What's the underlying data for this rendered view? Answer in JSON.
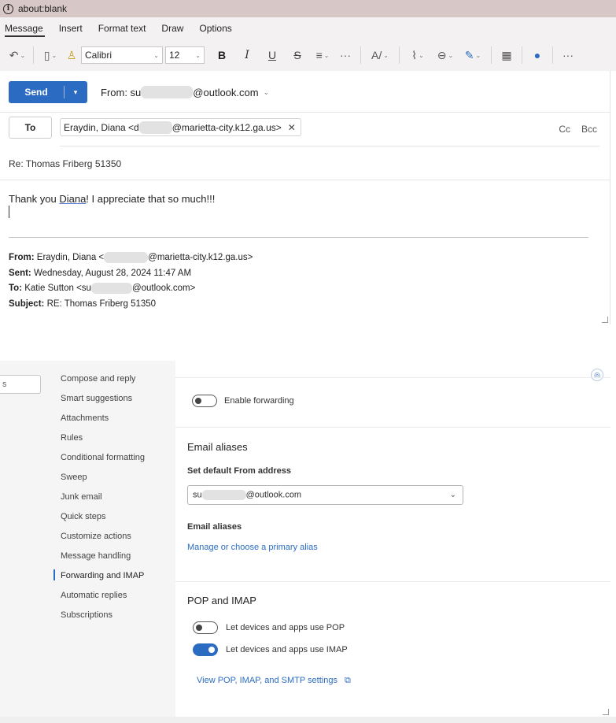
{
  "browser": {
    "url": "about:blank"
  },
  "tabs": [
    {
      "label": "Message",
      "active": true
    },
    {
      "label": "Insert",
      "active": false
    },
    {
      "label": "Format text",
      "active": false
    },
    {
      "label": "Draw",
      "active": false
    },
    {
      "label": "Options",
      "active": false
    }
  ],
  "ribbon": {
    "font_name": "Calibri",
    "font_size": "12",
    "bold": "B",
    "italic": "I",
    "underline": "U",
    "strike": "S",
    "more": "···"
  },
  "compose": {
    "send_label": "Send",
    "from_prefix": "From: su",
    "from_suffix": "@outlook.com",
    "to_label": "To",
    "recipient_prefix": "Eraydin, Diana <d",
    "recipient_suffix": "@marietta-city.k12.ga.us>",
    "cc_label": "Cc",
    "bcc_label": "Bcc",
    "subject": "Re: Thomas Friberg 51350",
    "body_pre": "Thank you ",
    "body_name": "Diana",
    "body_post": "!  I appreciate that so much!!!",
    "quoted": {
      "from_label": "From:",
      "from_prefix": " Eraydin, Diana <",
      "from_suffix": "@marietta-city.k12.ga.us>",
      "sent_label": "Sent:",
      "sent_value": " Wednesday, August 28, 2024 11:47 AM",
      "to_label": "To:",
      "to_prefix": " Katie Sutton <su",
      "to_suffix": "@outlook.com>",
      "subject_label": "Subject:",
      "subject_value": " RE: Thomas Friberg 51350"
    }
  },
  "settings": {
    "search_stub": "s",
    "nav_items": [
      {
        "label": "Compose and reply"
      },
      {
        "label": "Smart suggestions"
      },
      {
        "label": "Attachments"
      },
      {
        "label": "Rules"
      },
      {
        "label": "Conditional formatting"
      },
      {
        "label": "Sweep"
      },
      {
        "label": "Junk email"
      },
      {
        "label": "Quick steps"
      },
      {
        "label": "Customize actions"
      },
      {
        "label": "Message handling"
      },
      {
        "label": "Forwarding and IMAP",
        "active": true
      },
      {
        "label": "Automatic replies"
      },
      {
        "label": "Subscriptions"
      }
    ],
    "enable_forwarding_label": "Enable forwarding",
    "email_aliases_title": "Email aliases",
    "default_from_label": "Set default From address",
    "default_from_prefix": "su",
    "default_from_suffix": "@outlook.com",
    "aliases_sub": "Email aliases",
    "manage_alias_link": "Manage or choose a primary alias",
    "pop_imap_title": "POP and IMAP",
    "pop_label": "Let devices and apps use POP",
    "pop_enabled": false,
    "imap_label": "Let devices and apps use IMAP",
    "imap_enabled": true,
    "view_settings_link": "View POP, IMAP, and SMTP settings"
  }
}
